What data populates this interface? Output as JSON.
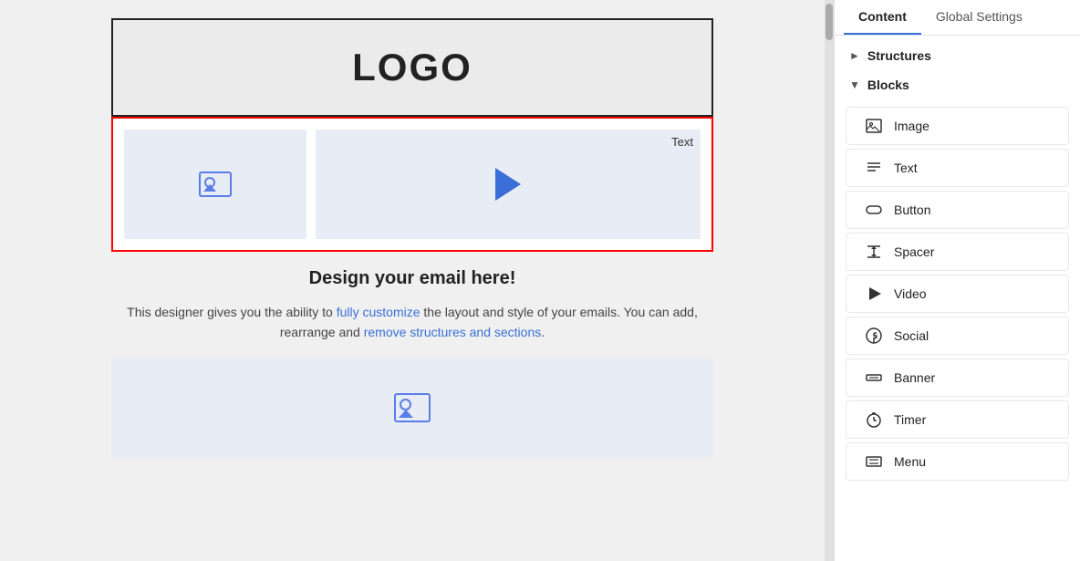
{
  "panel": {
    "tabs": [
      {
        "id": "content",
        "label": "Content",
        "active": true
      },
      {
        "id": "global-settings",
        "label": "Global Settings",
        "active": false
      }
    ],
    "sections": {
      "structures": {
        "label": "Structures",
        "expanded": false
      },
      "blocks": {
        "label": "Blocks",
        "expanded": true,
        "items": [
          {
            "id": "image",
            "label": "Image",
            "icon": "image-icon"
          },
          {
            "id": "text",
            "label": "Text",
            "icon": "text-icon"
          },
          {
            "id": "button",
            "label": "Button",
            "icon": "button-icon"
          },
          {
            "id": "spacer",
            "label": "Spacer",
            "icon": "spacer-icon"
          },
          {
            "id": "video",
            "label": "Video",
            "icon": "video-icon"
          },
          {
            "id": "social",
            "label": "Social",
            "icon": "social-icon"
          },
          {
            "id": "banner",
            "label": "Banner",
            "icon": "banner-icon"
          },
          {
            "id": "timer",
            "label": "Timer",
            "icon": "timer-icon"
          },
          {
            "id": "menu",
            "label": "Menu",
            "icon": "menu-icon"
          }
        ]
      }
    }
  },
  "canvas": {
    "logo_text": "LOGO",
    "content_block": {
      "text_label": "Text"
    },
    "design_heading": "Design your email here!",
    "design_description": "This designer gives you the ability to fully customize the layout and style of your emails. You can add, rearrange and remove structures and sections.",
    "design_description_highlighted": [
      "fully customize",
      "remove structures"
    ]
  }
}
